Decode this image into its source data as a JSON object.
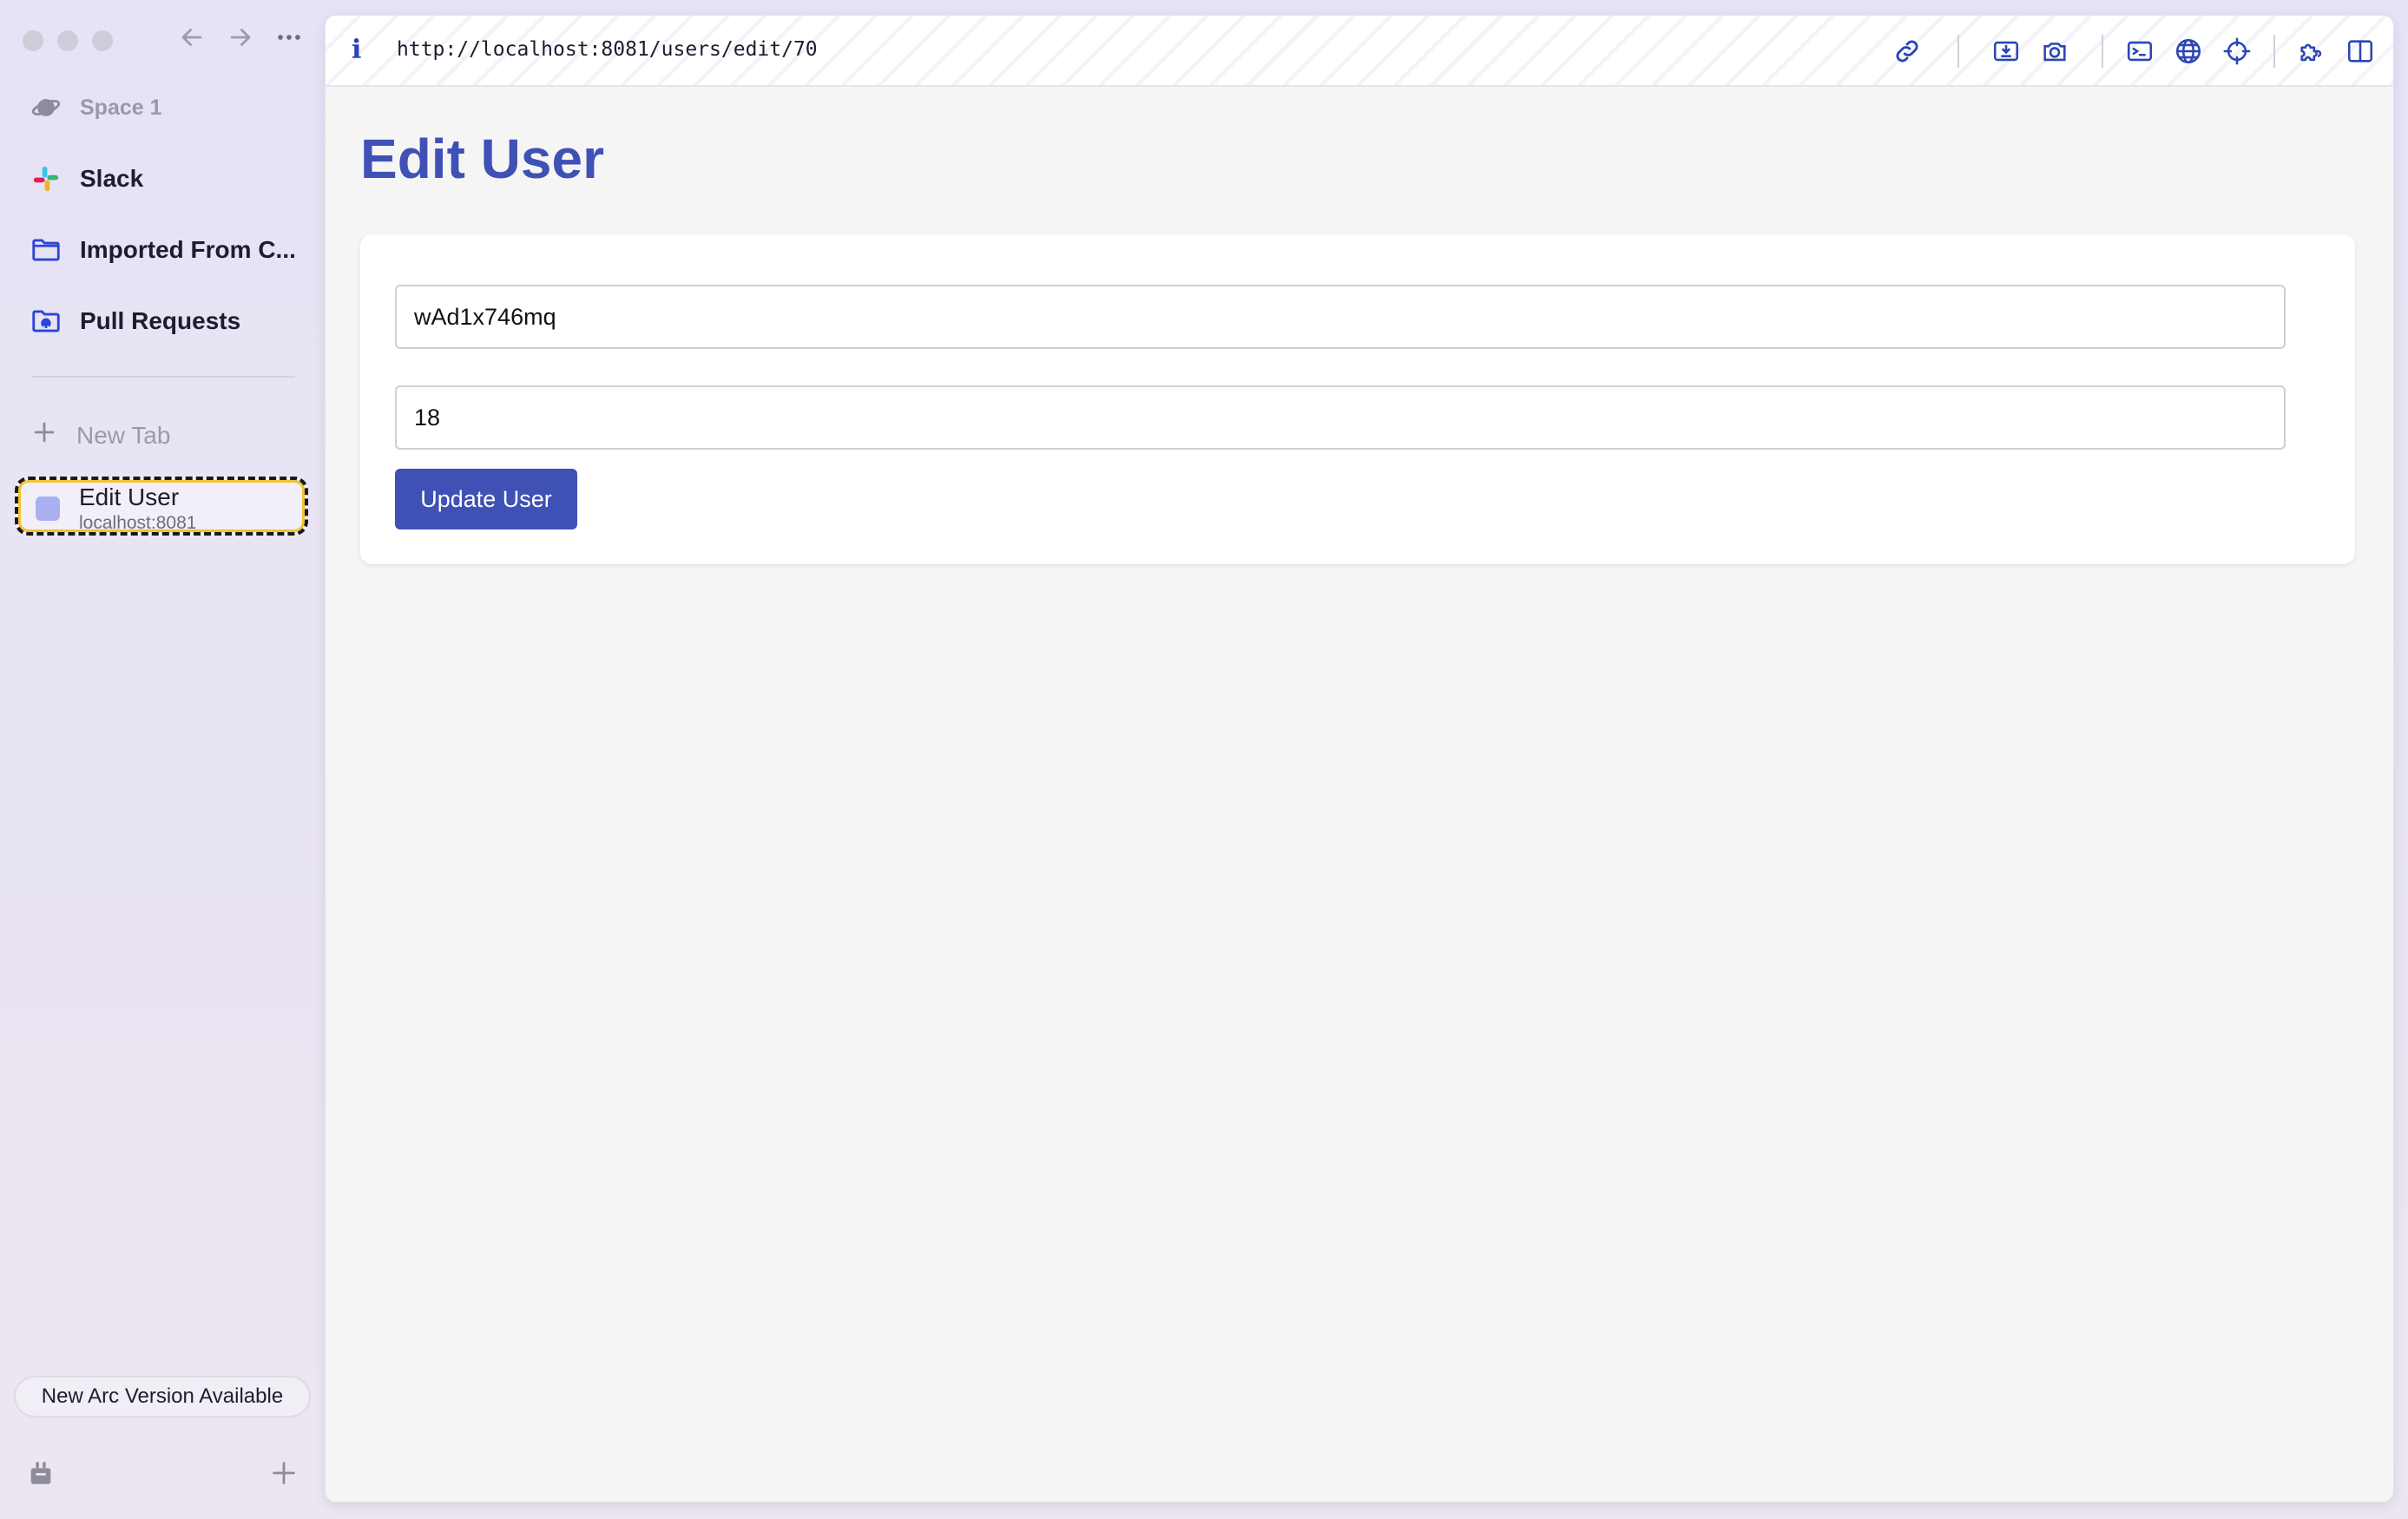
{
  "sidebar": {
    "space_label": "Space 1",
    "items": [
      {
        "label": "Slack",
        "icon": "slack-icon"
      },
      {
        "label": "Imported From C...",
        "icon": "folder-icon"
      },
      {
        "label": "Pull Requests",
        "icon": "github-folder-icon"
      }
    ],
    "new_tab_label": "New Tab",
    "active_tab": {
      "title": "Edit User",
      "subtitle": "localhost:8081"
    },
    "update_pill": "New Arc Version Available"
  },
  "browser": {
    "url": "http://localhost:8081/users/edit/70",
    "info_glyph": "i"
  },
  "page": {
    "title": "Edit User",
    "name_value": "wAd1x746mq",
    "age_value": "18",
    "submit_label": "Update User"
  },
  "colors": {
    "accent": "#3f51b5",
    "toolbar_icon": "#2b45b6"
  }
}
